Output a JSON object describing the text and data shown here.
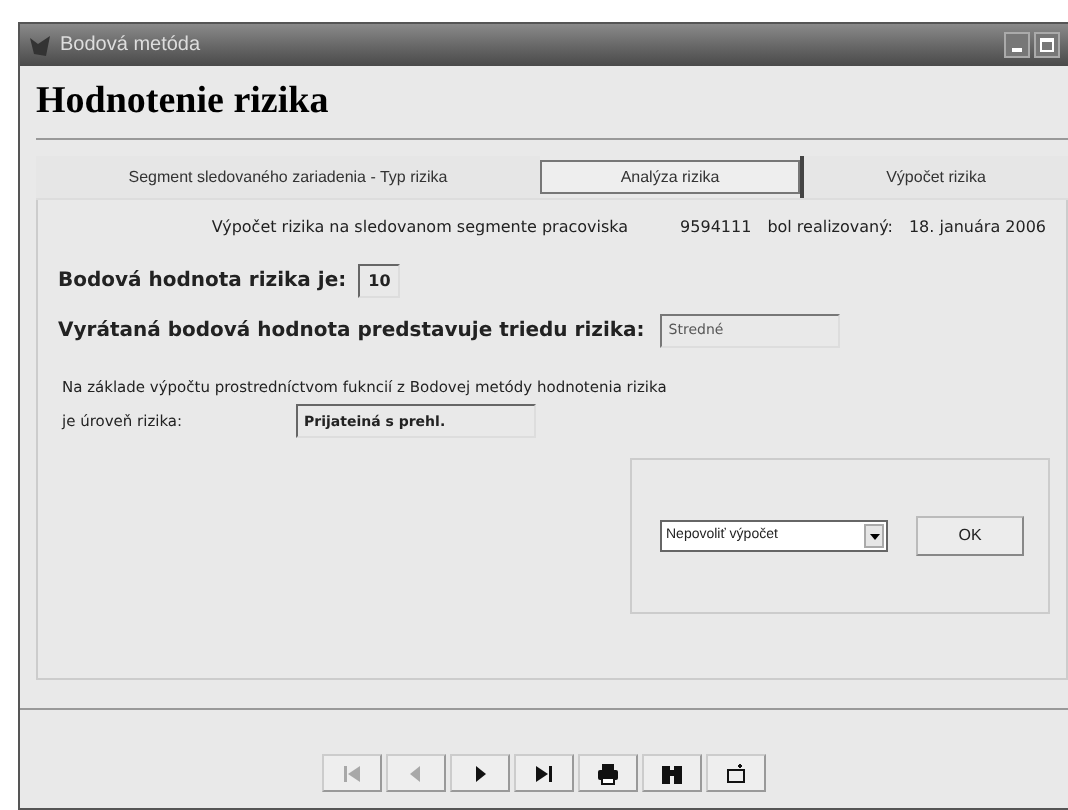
{
  "window": {
    "title": "Bodová metóda"
  },
  "heading": "Hodnotenie rizika",
  "tabs": [
    {
      "label": "Segment sledovaného zariadenia - Typ rizika",
      "selected": false
    },
    {
      "label": "Analýza rizika",
      "selected": true
    },
    {
      "label": "Výpočet rizika",
      "selected": false
    }
  ],
  "info": {
    "text": "Výpočet rizika na sledovanom segmente pracoviska",
    "code": "9594111",
    "status": "bol realizovaný:",
    "date": "18. januára 2006"
  },
  "score": {
    "label": "Bodová hodnota rizika je:",
    "value": "10"
  },
  "class": {
    "label": "Vyrátaná bodová hodnota predstavuje triedu rizika:",
    "value": "Stredné"
  },
  "level": {
    "note": "Na základe výpočtu prostredníctvom fukncií z Bodovej metódy hodnotenia rizika",
    "label": "je  úroveň rizika:",
    "value": "Prijateiná s prehl."
  },
  "action": {
    "select": "Nepovoliť výpočet",
    "button": "OK"
  },
  "nav": [
    {
      "kind": "first",
      "disabled": true
    },
    {
      "kind": "prev",
      "disabled": true
    },
    {
      "kind": "next",
      "disabled": false
    },
    {
      "kind": "last",
      "disabled": false
    },
    {
      "kind": "print",
      "disabled": false
    },
    {
      "kind": "find",
      "disabled": false
    },
    {
      "kind": "new",
      "disabled": false
    }
  ]
}
